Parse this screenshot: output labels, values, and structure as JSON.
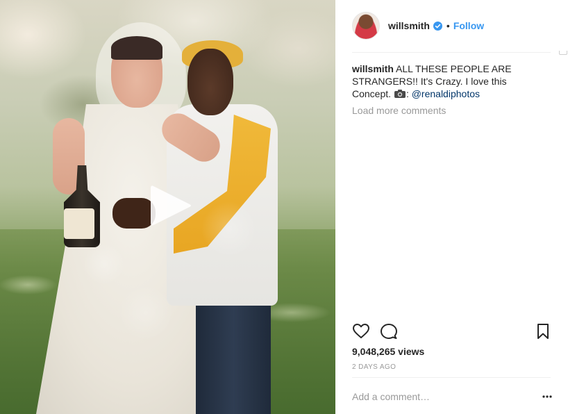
{
  "post": {
    "media": {
      "description_icon": "play-icon"
    },
    "header": {
      "username": "willsmith",
      "separator": "•",
      "follow_label": "Follow"
    },
    "caption": {
      "author": "willsmith",
      "text": "ALL THESE PEOPLE ARE STRANGERS!! It's Crazy. I love this Concept.",
      "camera_icon": "camera-icon",
      "after_icon": ":",
      "mention": "@renaldiphotos"
    },
    "load_more_label": "Load more comments",
    "actions": {
      "like_icon": "heart-icon",
      "comment_icon": "comment-icon",
      "save_icon": "bookmark-icon"
    },
    "views_label": "9,048,265 views",
    "timestamp": "2 DAYS AGO",
    "comment_box": {
      "placeholder": "Add a comment…",
      "more_icon": "more-options-icon"
    }
  },
  "colors": {
    "link": "#3897f0",
    "mention": "#003569",
    "muted": "#999999",
    "text": "#262626"
  }
}
